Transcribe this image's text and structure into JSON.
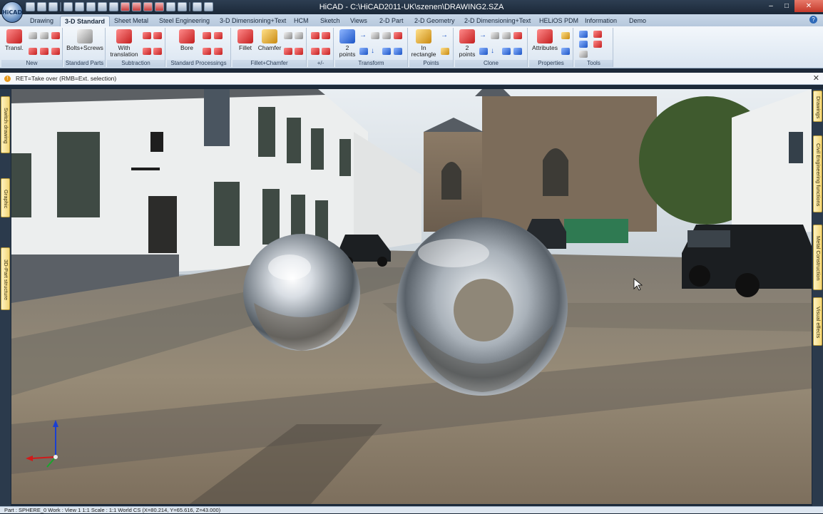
{
  "window": {
    "title": "HiCAD - C:\\HiCAD2011-UK\\szenen\\DRAWING2.SZA",
    "orb": "HiCAD",
    "controls": {
      "minimize": "–",
      "maximize": "□",
      "close": "✕"
    }
  },
  "tabs": [
    "Drawing",
    "3-D Standard",
    "Sheet Metal",
    "Steel Engineering",
    "3-D Dimensioning+Text",
    "HCM",
    "Sketch",
    "Views",
    "2-D Part",
    "2-D Geometry",
    "2-D Dimensioning+Text",
    "HELiOS PDM",
    "Information",
    "Demo"
  ],
  "active_tab": "3-D Standard",
  "help_label": "?",
  "ribbon": {
    "groups": [
      "New",
      "Standard Parts",
      "Subtraction",
      "Standard Processings",
      "Fillet+Chamfer",
      "+/-",
      "Transform",
      "Points",
      "Clone",
      "Properties",
      "Tools"
    ],
    "buttons": {
      "transl": "Transl.",
      "bolts": "Bolts+Screws",
      "with_translation_1": "With",
      "with_translation_2": "translation",
      "bore": "Bore",
      "fillet": "Fillet",
      "chamfer": "Chamfer",
      "two_points_a_1": "2",
      "two_points_a_2": "points",
      "in_rectangle_1": "In",
      "in_rectangle_2": "rectangle",
      "two_points_b_1": "2",
      "two_points_b_2": "points",
      "attributes": "Attributes"
    }
  },
  "command_line": {
    "icon": "!",
    "text": "RET=Take over (RMB=Ext. selection)",
    "close": "✕"
  },
  "left_dock": [
    "Switch drawing",
    "Graphic",
    "3D-Part structure"
  ],
  "right_dock": [
    "Drawings",
    "Civil Engineering functions",
    "Metal Construction",
    "Visual effects"
  ],
  "status_bar": {
    "text": "Part : SPHERE_0   Work : View 1 1:1   Scale : 1:1   World CS (X=80.214, Y=65.616, Z=43.000)"
  },
  "colors": {
    "title_bar": "#1f2d3f",
    "ribbon": "#dde8f3",
    "accent": "#2f6ab8",
    "dock_tab": "#f3d676"
  }
}
